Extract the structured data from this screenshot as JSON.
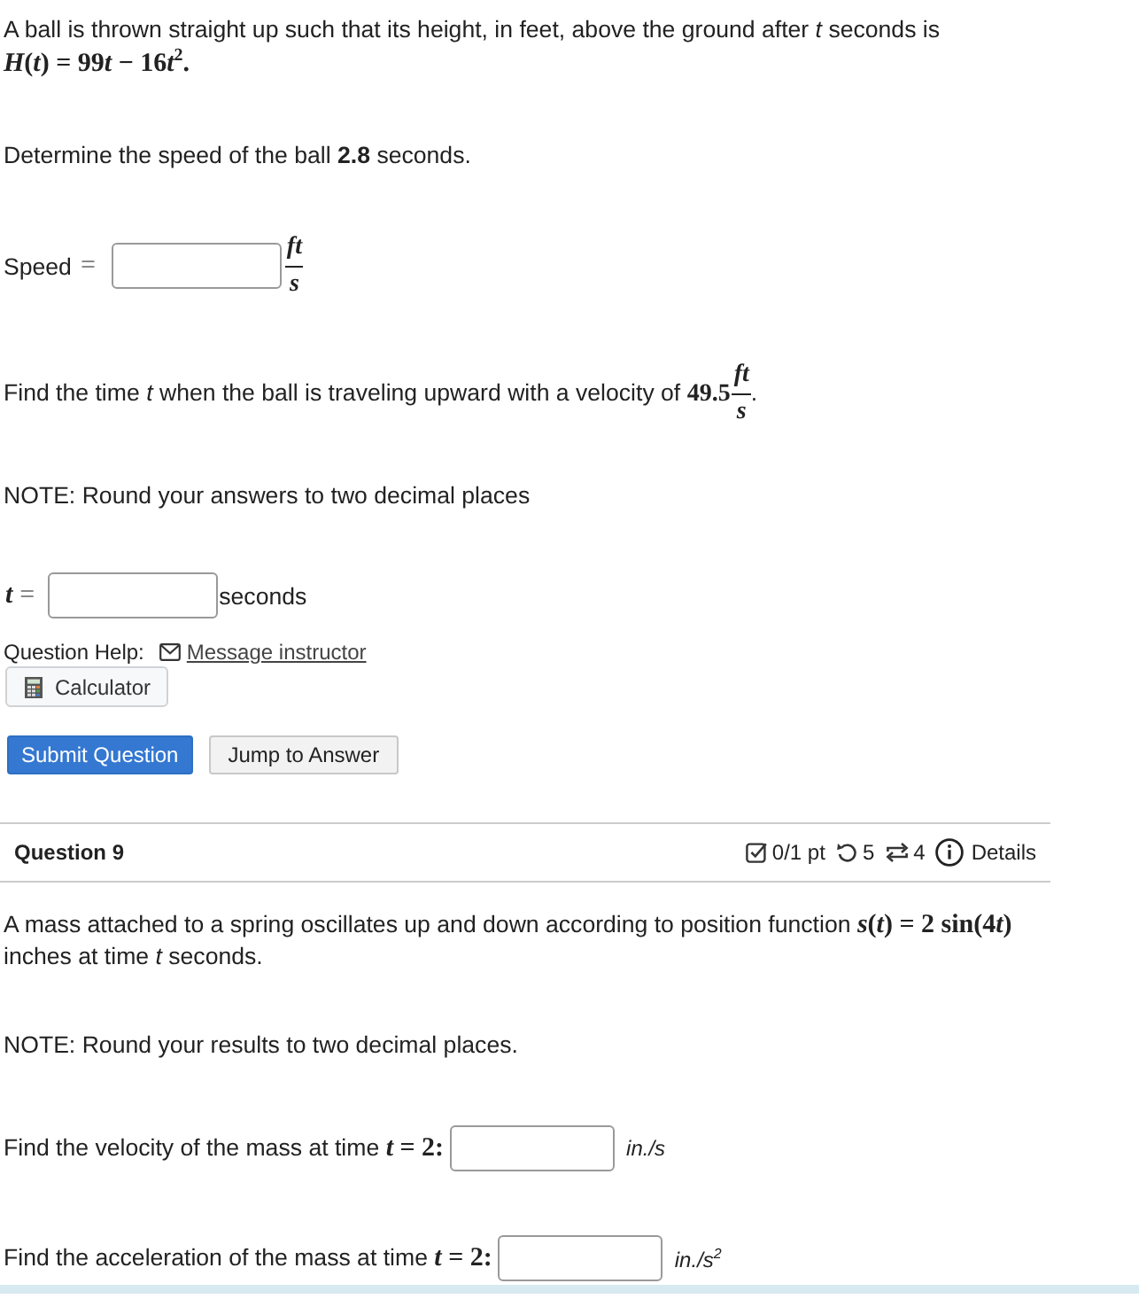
{
  "question_8": {
    "intro": "A ball is thrown straight up such that its height, in feet, above the ground after *t* seconds is",
    "formula": "H(t) = 99t − 16t$^{2}$.",
    "prompt": "Determine the speed of the ball **2.8** seconds.",
    "speed_answer": {
      "label": "Speed",
      "relation": "=",
      "unit_numerator": "ft",
      "unit_denominator": "s"
    },
    "time_prompt": {
      "text": "Find the time *t* when the ball is traveling upward with a velocity of",
      "value": "49.5",
      "unit_numerator": "ft",
      "unit_denominator": "s",
      "end": "."
    },
    "note": "NOTE: Round your answers to two decimal places",
    "time_answer": {
      "label": "t",
      "relation": "=",
      "unit": "seconds"
    },
    "help": {
      "label": "Question Help:",
      "link": "Message instructor",
      "calculator": "Calculator"
    },
    "buttons": [
      {
        "label": "Submit Question",
        "kind": "primary"
      },
      {
        "label": "Jump to Answer",
        "kind": "secondary"
      }
    ]
  },
  "question_9": {
    "title": "Question 9",
    "score": "0/1 pt",
    "retries": "5",
    "versions": "4",
    "details": "Details",
    "statement": {
      "text": "A mass attached to a spring oscillates up and down according to position function",
      "math": "s(t) = 2 sin(4t)",
      "end": "inches at time *t* seconds."
    },
    "note": "NOTE: Round your results to two decimal places.",
    "answers": [
      {
        "text": "Find the velocity of the mass at time",
        "math": "t = 2:",
        "unit": "in./s"
      },
      {
        "text": "Find the acceleration of the mass at time",
        "math": "t = 2:",
        "unit": "in./s$^{2}$"
      }
    ]
  }
}
